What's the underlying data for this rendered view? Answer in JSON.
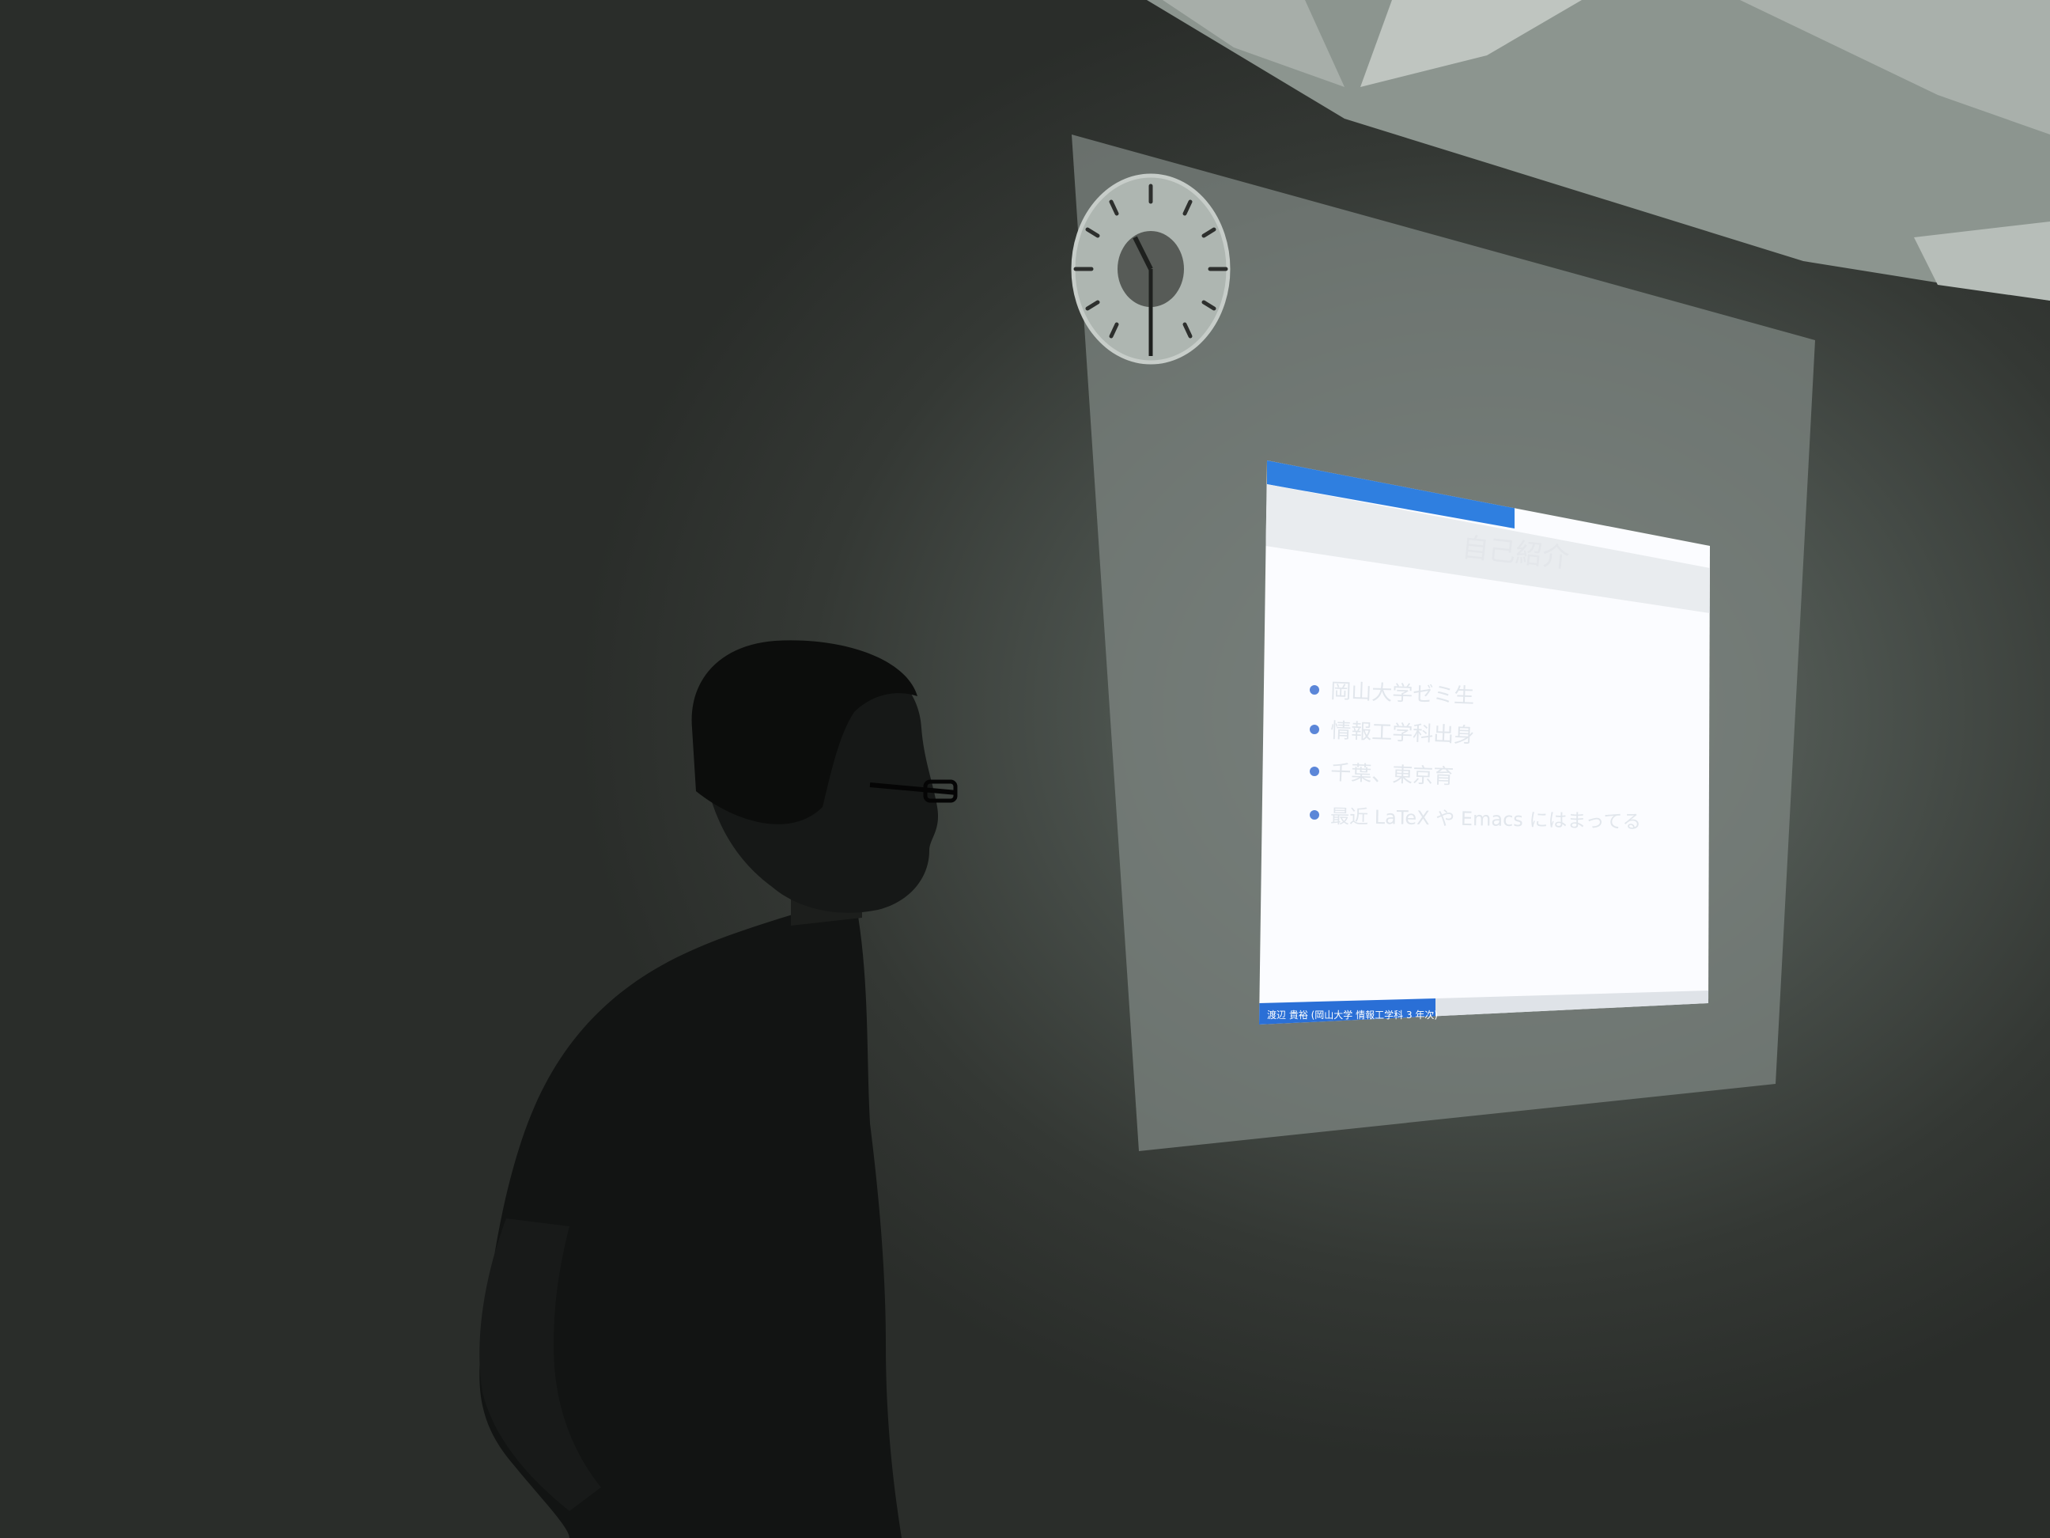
{
  "scene": {
    "colors": {
      "wall": "#4c534e",
      "ceiling": "#8c958f",
      "slide_background": "#fbfcff",
      "slide_header_bar": "#2f7fe0",
      "slide_footer_bar": "#2a6fd6",
      "bullet": "#5b86d8",
      "silhouette": "#111312"
    }
  },
  "slide": {
    "title": "自己紹介",
    "bullets": [
      "岡山大学ゼミ生",
      "情報工学科出身",
      "千葉、東京育",
      "最近 LaTeX や Emacs にはまってる"
    ],
    "footer": "渡辺 貴裕 (岡山大学 情報工学科 3 年次)"
  }
}
